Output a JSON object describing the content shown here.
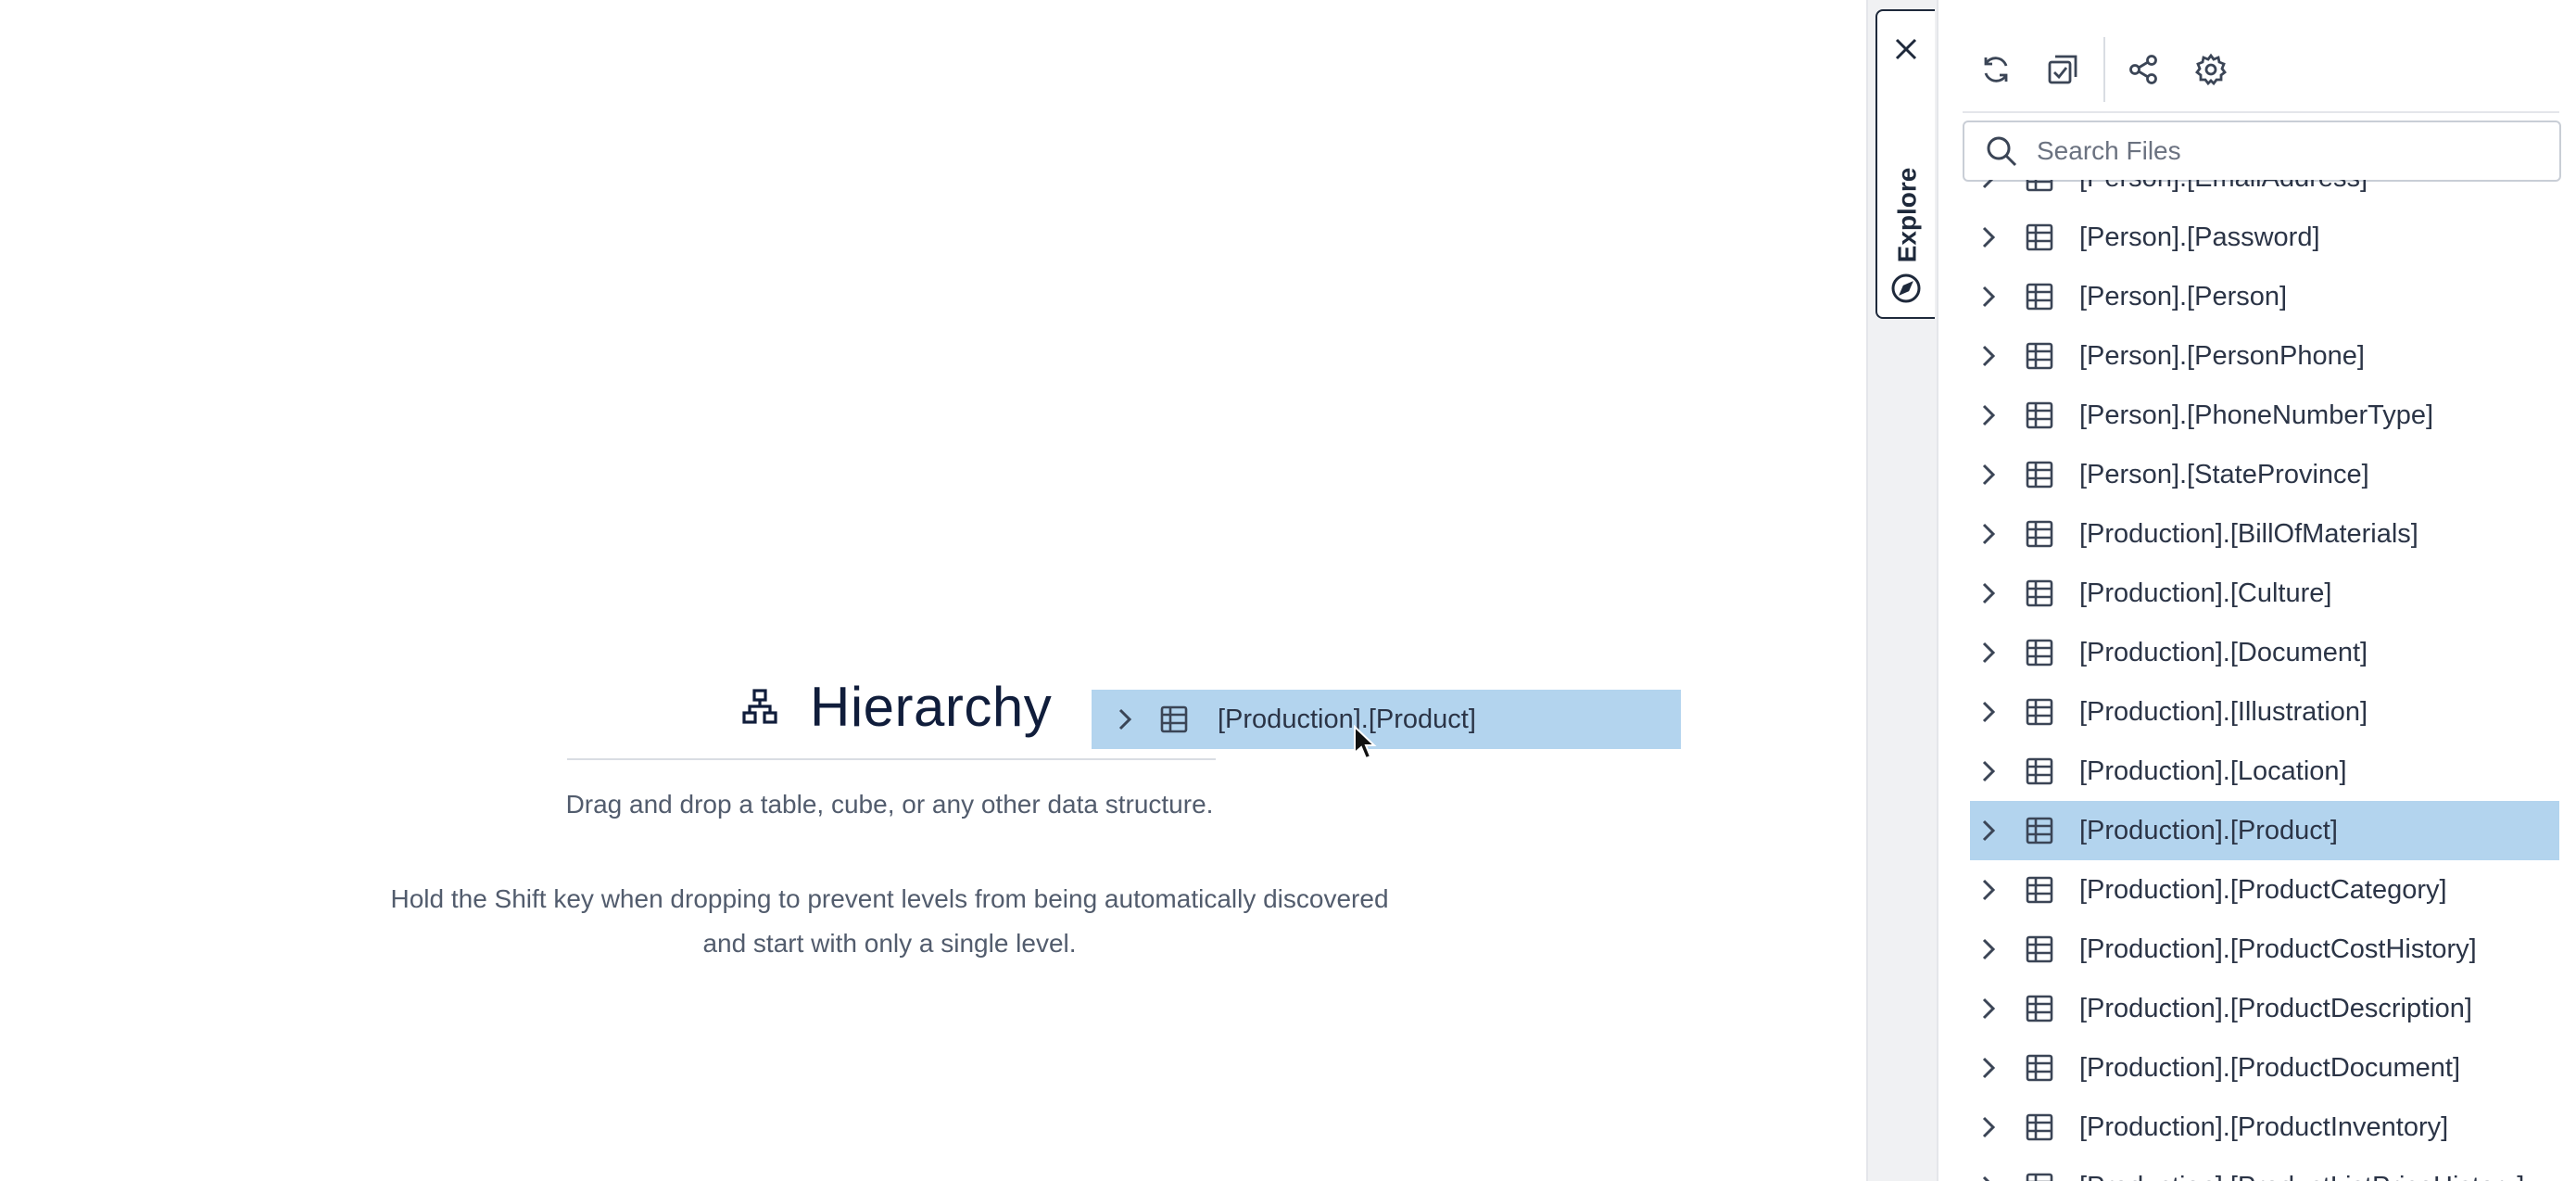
{
  "canvas": {
    "title": "Hierarchy",
    "hint_primary": "Drag and drop a table, cube, or any other data structure.",
    "hint_secondary": "Hold the Shift key when dropping to prevent levels from being automatically discovered and start with only a single level."
  },
  "drag_item": {
    "label": "[Production].[Product]"
  },
  "panel": {
    "tab_label": "Explore",
    "search_placeholder": "Search Files",
    "items": [
      {
        "label": "[Person].[EmailAddress]",
        "selected": false
      },
      {
        "label": "[Person].[Password]",
        "selected": false
      },
      {
        "label": "[Person].[Person]",
        "selected": false
      },
      {
        "label": "[Person].[PersonPhone]",
        "selected": false
      },
      {
        "label": "[Person].[PhoneNumberType]",
        "selected": false
      },
      {
        "label": "[Person].[StateProvince]",
        "selected": false
      },
      {
        "label": "[Production].[BillOfMaterials]",
        "selected": false
      },
      {
        "label": "[Production].[Culture]",
        "selected": false
      },
      {
        "label": "[Production].[Document]",
        "selected": false
      },
      {
        "label": "[Production].[Illustration]",
        "selected": false
      },
      {
        "label": "[Production].[Location]",
        "selected": false
      },
      {
        "label": "[Production].[Product]",
        "selected": true
      },
      {
        "label": "[Production].[ProductCategory]",
        "selected": false
      },
      {
        "label": "[Production].[ProductCostHistory]",
        "selected": false
      },
      {
        "label": "[Production].[ProductDescription]",
        "selected": false
      },
      {
        "label": "[Production].[ProductDocument]",
        "selected": false
      },
      {
        "label": "[Production].[ProductInventory]",
        "selected": false
      },
      {
        "label": "[Production].[ProductListPriceHistory]",
        "selected": false
      }
    ]
  },
  "colors": {
    "selection": "#b3d4ee",
    "text": "#2b3446",
    "icon": "#3b4556"
  }
}
